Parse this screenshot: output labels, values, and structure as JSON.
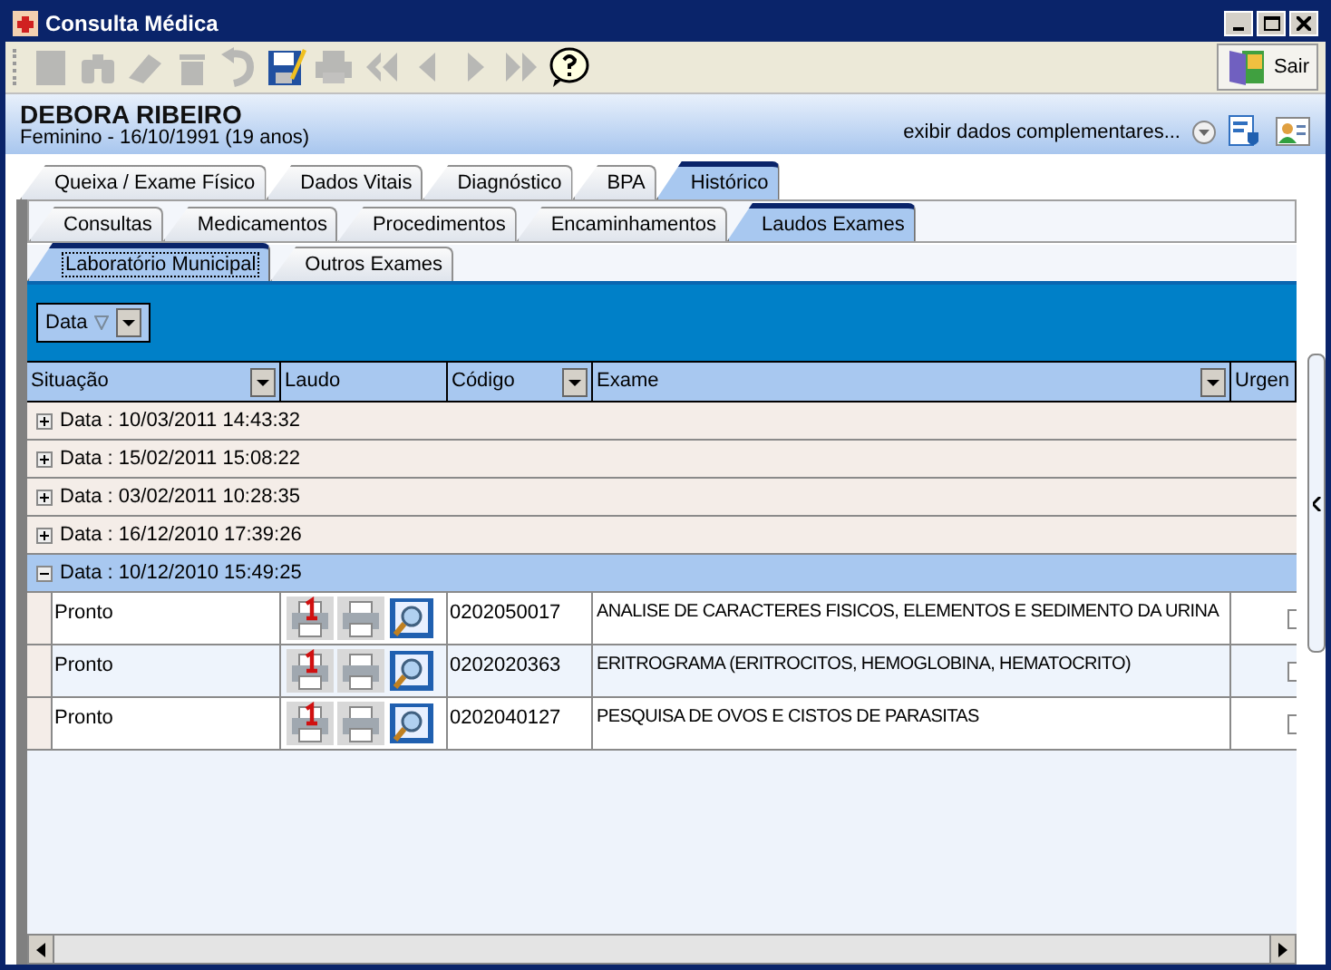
{
  "window": {
    "title": "Consulta Médica"
  },
  "toolbar": [
    {
      "kind": "new",
      "disabled": true
    },
    {
      "kind": "find",
      "disabled": true
    },
    {
      "kind": "erase",
      "disabled": true
    },
    {
      "kind": "delete",
      "disabled": true
    },
    {
      "kind": "undo",
      "disabled": true
    },
    {
      "kind": "edit",
      "disabled": false
    },
    {
      "kind": "print",
      "disabled": true
    },
    {
      "kind": "first",
      "disabled": true
    },
    {
      "kind": "prev",
      "disabled": true
    },
    {
      "kind": "next",
      "disabled": true
    },
    {
      "kind": "last",
      "disabled": true
    },
    {
      "kind": "help",
      "disabled": false
    }
  ],
  "exit_button": {
    "label": "Sair"
  },
  "patient": {
    "name": "DEBORA RIBEIRO",
    "details": "Feminino - 16/10/1991 (19 anos)",
    "more_link": "exibir dados complementares..."
  },
  "tabs": [
    {
      "label": "Queixa / Exame Físico",
      "selected": false
    },
    {
      "label": "Dados Vitais",
      "selected": false
    },
    {
      "label": "Diagnóstico",
      "selected": false
    },
    {
      "label": "BPA",
      "selected": false
    },
    {
      "label": "Histórico",
      "selected": true
    }
  ],
  "subtabs": [
    {
      "label": "Consultas",
      "selected": false
    },
    {
      "label": "Medicamentos",
      "selected": false
    },
    {
      "label": "Procedimentos",
      "selected": false
    },
    {
      "label": "Encaminhamentos",
      "selected": false
    },
    {
      "label": "Laudos Exames",
      "selected": true
    }
  ],
  "lab_tabs": [
    {
      "label": "Laboratório Municipal",
      "selected": true
    },
    {
      "label": "Outros Exames",
      "selected": false
    }
  ],
  "group_by": {
    "label": "Data"
  },
  "table": {
    "columns": [
      {
        "label": "Situação",
        "filter": true
      },
      {
        "label": "Laudo",
        "filter": false
      },
      {
        "label": "Código",
        "filter": true
      },
      {
        "label": "Exame",
        "filter": true
      },
      {
        "label": "Urgen",
        "filter": false
      }
    ],
    "groups": [
      {
        "label": "Data : 10/03/2011 14:43:32",
        "expanded": false,
        "selected": false
      },
      {
        "label": "Data : 15/02/2011 15:08:22",
        "expanded": false,
        "selected": false
      },
      {
        "label": "Data : 03/02/2011 10:28:35",
        "expanded": false,
        "selected": false
      },
      {
        "label": "Data : 16/12/2010 17:39:26",
        "expanded": false,
        "selected": false
      },
      {
        "label": "Data : 10/12/2010 15:49:25",
        "expanded": true,
        "selected": true,
        "rows": [
          {
            "status": "Pronto",
            "code": "0202050017",
            "exam": "ANALISE DE CARACTERES FISICOS, ELEMENTOS E SEDIMENTO DA URINA",
            "urgent": false
          },
          {
            "status": "Pronto",
            "code": "0202020363",
            "exam": "ERITROGRAMA (ERITROCITOS, HEMOGLOBINA, HEMATOCRITO)",
            "urgent": false
          },
          {
            "status": "Pronto",
            "code": "0202040127",
            "exam": "PESQUISA DE OVOS E CISTOS DE PARASITAS",
            "urgent": false
          }
        ]
      }
    ]
  }
}
